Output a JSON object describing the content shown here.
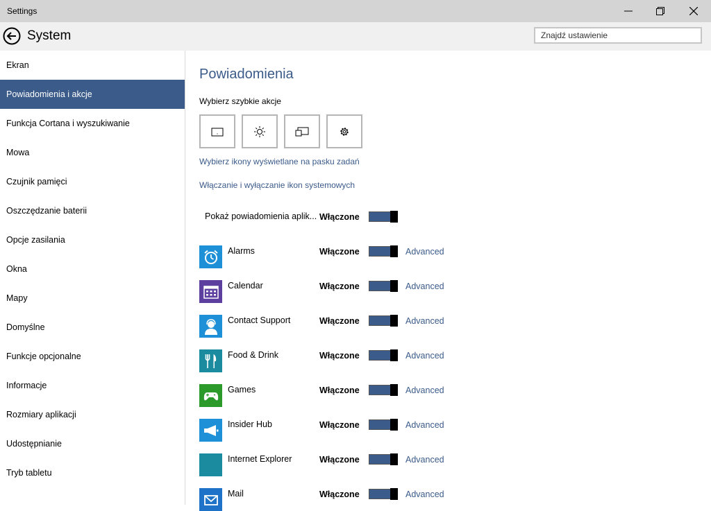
{
  "window": {
    "title": "Settings"
  },
  "header": {
    "title": "System",
    "search_placeholder": "Znajdź ustawienie"
  },
  "sidebar": {
    "items": [
      {
        "label": "Ekran",
        "active": false
      },
      {
        "label": "Powiadomienia i akcje",
        "active": true
      },
      {
        "label": "Funkcja Cortana i wyszukiwanie",
        "active": false
      },
      {
        "label": "Mowa",
        "active": false
      },
      {
        "label": "Czujnik pamięci",
        "active": false
      },
      {
        "label": "Oszczędzanie baterii",
        "active": false
      },
      {
        "label": "Opcje zasilania",
        "active": false
      },
      {
        "label": "Okna",
        "active": false
      },
      {
        "label": "Mapy",
        "active": false
      },
      {
        "label": "Domyślne",
        "active": false
      },
      {
        "label": "Funkcje opcjonalne",
        "active": false
      },
      {
        "label": "Informacje",
        "active": false
      },
      {
        "label": "Rozmiary aplikacji",
        "active": false
      },
      {
        "label": "Udostępnianie",
        "active": false
      },
      {
        "label": "Tryb tabletu",
        "active": false
      }
    ]
  },
  "main": {
    "title": "Powiadomienia",
    "quick_actions_label": "Wybierz szybkie akcje",
    "quick_actions": [
      {
        "icon": "tablet-icon"
      },
      {
        "icon": "brightness-icon"
      },
      {
        "icon": "project-icon"
      },
      {
        "icon": "gear-icon"
      }
    ],
    "link_taskbar_icons": "Wybierz ikony wyświetlane na pasku zadań",
    "link_system_icons": "Włączanie i wyłączanie ikon systemowych",
    "show_notifications": {
      "label": "Pokaż powiadomienia aplik...",
      "state": "Włączone"
    },
    "apps": [
      {
        "name": "Alarms",
        "state": "Włączone",
        "advanced": "Advanced",
        "icon": "alarm-clock-icon",
        "color": "#1e90d8"
      },
      {
        "name": "Calendar",
        "state": "Włączone",
        "advanced": "Advanced",
        "icon": "calendar-icon",
        "color": "#5d3fa0"
      },
      {
        "name": "Contact Support",
        "state": "Włączone",
        "advanced": "Advanced",
        "icon": "support-person-icon",
        "color": "#1e90d8"
      },
      {
        "name": "Food & Drink",
        "state": "Włączone",
        "advanced": "Advanced",
        "icon": "fork-knife-icon",
        "color": "#1b8ca0"
      },
      {
        "name": "Games",
        "state": "Włączone",
        "advanced": "Advanced",
        "icon": "xbox-controller-icon",
        "color": "#2b9a2b"
      },
      {
        "name": "Insider Hub",
        "state": "Włączone",
        "advanced": "Advanced",
        "icon": "megaphone-icon",
        "color": "#1e90d8"
      },
      {
        "name": "Internet Explorer",
        "state": "Włączone",
        "advanced": "Advanced",
        "icon": "blank-tile-icon",
        "color": "#1b8ca0"
      },
      {
        "name": "Mail",
        "state": "Włączone",
        "advanced": "Advanced",
        "icon": "envelope-icon",
        "color": "#1e73c8"
      }
    ]
  },
  "colors": {
    "accent": "#3b5b8a",
    "titlebar": "#d4d4d4",
    "header": "#f0f0f0"
  }
}
